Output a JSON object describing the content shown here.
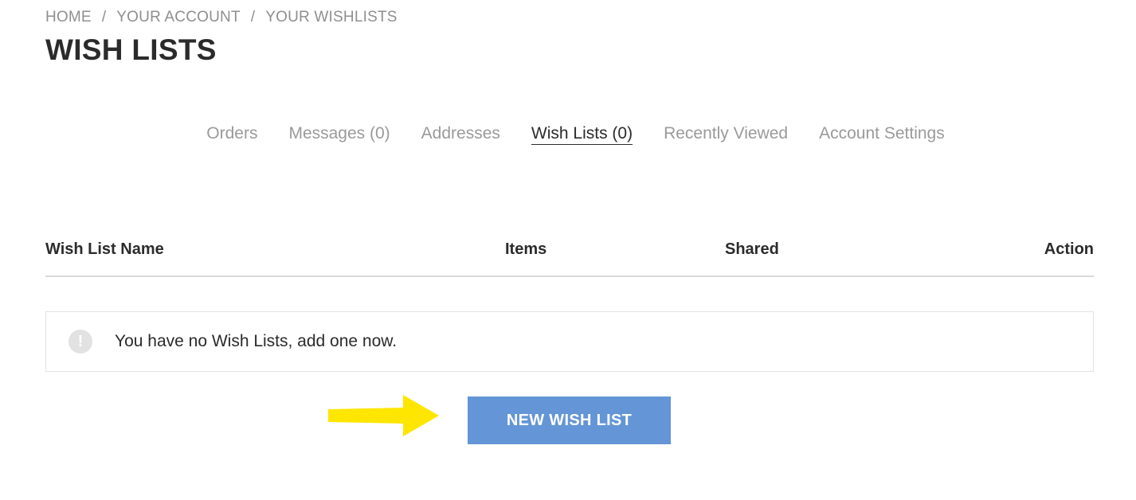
{
  "breadcrumb": {
    "items": [
      "HOME",
      "YOUR ACCOUNT",
      "YOUR WISHLISTS"
    ],
    "separator": "/"
  },
  "page_title": "WISH LISTS",
  "account_nav": {
    "items": [
      {
        "label": "Orders",
        "active": false
      },
      {
        "label": "Messages (0)",
        "active": false
      },
      {
        "label": "Addresses",
        "active": false
      },
      {
        "label": "Wish Lists (0)",
        "active": true
      },
      {
        "label": "Recently Viewed",
        "active": false
      },
      {
        "label": "Account Settings",
        "active": false
      }
    ]
  },
  "table": {
    "headers": [
      "Wish List Name",
      "Items",
      "Shared",
      "Action"
    ]
  },
  "alert": {
    "icon": "exclamation-icon",
    "glyph": "!",
    "message": "You have no Wish Lists, add one now."
  },
  "new_wishlist_button": {
    "label": "NEW WISH LIST",
    "color": "#6495d6"
  },
  "annotation": {
    "icon": "arrow-right-icon",
    "color": "#ffe600"
  }
}
